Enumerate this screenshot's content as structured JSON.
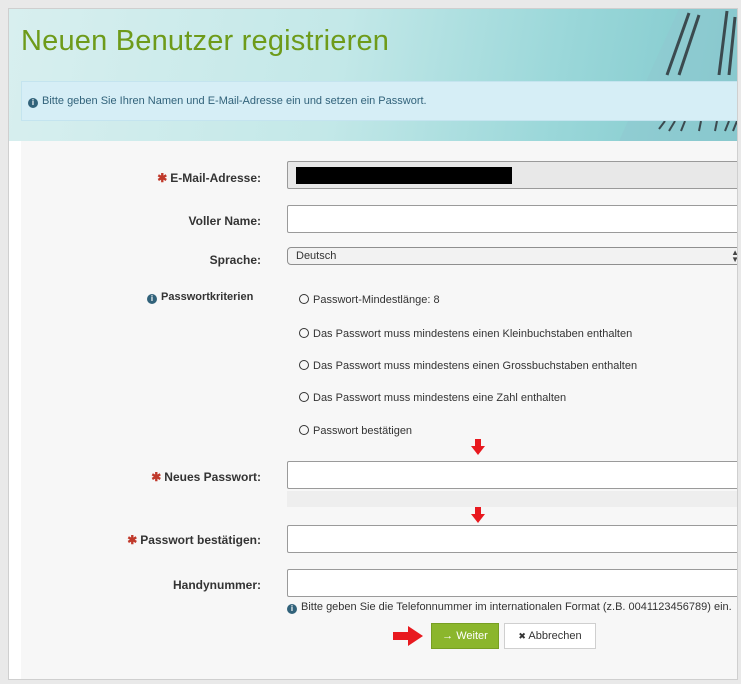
{
  "page": {
    "title": "Neuen Benutzer registrieren",
    "info_text": "Bitte geben Sie Ihren Namen und E-Mail-Adresse ein und setzen ein Passwort."
  },
  "form": {
    "email_label": "E-Mail-Adresse:",
    "fullname_label": "Voller Name:",
    "language_label": "Sprache:",
    "language_value": "Deutsch",
    "criteria_label": "Passwortkriterien",
    "criteria": [
      "Passwort-Mindestlänge: 8",
      "Das Passwort muss mindestens einen Kleinbuchstaben enthalten",
      "Das Passwort muss mindestens einen Grossbuchstaben enthalten",
      "Das Passwort muss mindestens eine Zahl enthalten",
      "Passwort bestätigen"
    ],
    "new_password_label": "Neues Passwort:",
    "confirm_password_label": "Passwort bestätigen:",
    "phone_label": "Handynummer:",
    "phone_hint": "Bitte geben Sie die Telefonnummer im internationalen Format (z.B. 0041123456789) ein.",
    "required_mark": "✱",
    "info_icon": "i"
  },
  "buttons": {
    "next_label": "Weiter",
    "next_icon": "→",
    "cancel_label": "Abbrechen",
    "cancel_icon": "✖"
  },
  "colors": {
    "title": "#6e9b1a",
    "required": "#c0392b",
    "next_button": "#8bb62c",
    "annotation_arrow": "#e8191f",
    "info_bar": "#d6eef6"
  }
}
